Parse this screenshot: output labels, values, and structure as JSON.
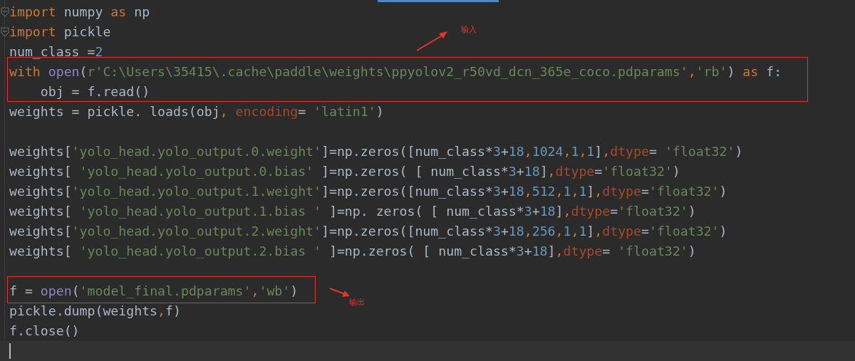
{
  "editor": {
    "lines": [
      {
        "tokens": [
          {
            "text": "import",
            "kind": "keyword"
          },
          {
            "text": " numpy ",
            "kind": "plain"
          },
          {
            "text": "as",
            "kind": "keyword"
          },
          {
            "text": " np",
            "kind": "plain"
          }
        ],
        "folded_marker": true
      },
      {
        "tokens": [
          {
            "text": "import",
            "kind": "keyword"
          },
          {
            "text": " pickle",
            "kind": "plain"
          }
        ],
        "folded_marker": true
      },
      {
        "tokens": [
          {
            "text": "num_class =",
            "kind": "plain"
          },
          {
            "text": "2",
            "kind": "number"
          }
        ]
      },
      {
        "tokens": [
          {
            "text": "with ",
            "kind": "keyword"
          },
          {
            "text": "open",
            "kind": "builtin"
          },
          {
            "text": "(",
            "kind": "plain"
          },
          {
            "text": "r'C:\\Users\\35415\\.cache\\paddle\\weights\\ppyolov2_r50vd_dcn_365e_coco.pdparams'",
            "kind": "string"
          },
          {
            "text": ",",
            "kind": "keyword"
          },
          {
            "text": "'rb'",
            "kind": "string"
          },
          {
            "text": ") ",
            "kind": "plain"
          },
          {
            "text": "as",
            "kind": "keyword"
          },
          {
            "text": " f:",
            "kind": "plain"
          }
        ]
      },
      {
        "tokens": [
          {
            "text": "    obj = f.read()",
            "kind": "plain"
          }
        ]
      },
      {
        "tokens": [
          {
            "text": "weights = pickle. loads(obj",
            "kind": "plain"
          },
          {
            "text": ", ",
            "kind": "keyword"
          },
          {
            "text": "encoding",
            "kind": "param"
          },
          {
            "text": "= ",
            "kind": "plain"
          },
          {
            "text": "'latin1'",
            "kind": "string"
          },
          {
            "text": ")",
            "kind": "plain"
          }
        ]
      },
      {
        "kind": "blank"
      },
      {
        "tokens": [
          {
            "text": "weights[",
            "kind": "plain"
          },
          {
            "text": "'yolo_head.yolo_output.0.weight'",
            "kind": "string"
          },
          {
            "text": "]=np.zeros([num_class*",
            "kind": "plain"
          },
          {
            "text": "3",
            "kind": "number"
          },
          {
            "text": "+",
            "kind": "plain"
          },
          {
            "text": "18",
            "kind": "number"
          },
          {
            "text": ",",
            "kind": "keyword"
          },
          {
            "text": "1024",
            "kind": "number"
          },
          {
            "text": ",",
            "kind": "keyword"
          },
          {
            "text": "1",
            "kind": "number"
          },
          {
            "text": ",",
            "kind": "keyword"
          },
          {
            "text": "1",
            "kind": "number"
          },
          {
            "text": "]",
            "kind": "plain"
          },
          {
            "text": ",",
            "kind": "keyword"
          },
          {
            "text": "dtype",
            "kind": "param"
          },
          {
            "text": "= ",
            "kind": "plain"
          },
          {
            "text": "'float32'",
            "kind": "string"
          },
          {
            "text": ")",
            "kind": "plain"
          }
        ]
      },
      {
        "tokens": [
          {
            "text": "weights[ ",
            "kind": "plain"
          },
          {
            "text": "'yolo_head.yolo_output.0.bias'",
            "kind": "string"
          },
          {
            "text": " ]=np.zeros( [ num_class*",
            "kind": "plain"
          },
          {
            "text": "3",
            "kind": "number"
          },
          {
            "text": "+",
            "kind": "plain"
          },
          {
            "text": "18",
            "kind": "number"
          },
          {
            "text": "]",
            "kind": "plain"
          },
          {
            "text": ",",
            "kind": "keyword"
          },
          {
            "text": "dtype",
            "kind": "param"
          },
          {
            "text": "=",
            "kind": "plain"
          },
          {
            "text": "'float32'",
            "kind": "string"
          },
          {
            "text": ")",
            "kind": "plain"
          }
        ]
      },
      {
        "tokens": [
          {
            "text": "weights[",
            "kind": "plain"
          },
          {
            "text": "'yolo_head.yolo_output.1.weight'",
            "kind": "string"
          },
          {
            "text": "]=np.zeros([num_class*",
            "kind": "plain"
          },
          {
            "text": "3",
            "kind": "number"
          },
          {
            "text": "+",
            "kind": "plain"
          },
          {
            "text": "18",
            "kind": "number"
          },
          {
            "text": ",",
            "kind": "keyword"
          },
          {
            "text": "512",
            "kind": "number"
          },
          {
            "text": ",",
            "kind": "keyword"
          },
          {
            "text": "1",
            "kind": "number"
          },
          {
            "text": ",",
            "kind": "keyword"
          },
          {
            "text": "1",
            "kind": "number"
          },
          {
            "text": "]",
            "kind": "plain"
          },
          {
            "text": ",",
            "kind": "keyword"
          },
          {
            "text": "dtype",
            "kind": "param"
          },
          {
            "text": "=",
            "kind": "plain"
          },
          {
            "text": "'float32'",
            "kind": "string"
          },
          {
            "text": ")",
            "kind": "plain"
          }
        ]
      },
      {
        "tokens": [
          {
            "text": "weights[ ",
            "kind": "plain"
          },
          {
            "text": "'yolo_head.yolo_output.1.bias '",
            "kind": "string"
          },
          {
            "text": " ]=np. zeros( [ num_class*",
            "kind": "plain"
          },
          {
            "text": "3",
            "kind": "number"
          },
          {
            "text": "+",
            "kind": "plain"
          },
          {
            "text": "18",
            "kind": "number"
          },
          {
            "text": "]",
            "kind": "plain"
          },
          {
            "text": ",",
            "kind": "keyword"
          },
          {
            "text": "dtype",
            "kind": "param"
          },
          {
            "text": "=",
            "kind": "plain"
          },
          {
            "text": "'float32'",
            "kind": "string"
          },
          {
            "text": ")",
            "kind": "plain"
          }
        ]
      },
      {
        "tokens": [
          {
            "text": "weights[",
            "kind": "plain"
          },
          {
            "text": "'yolo_head.yolo_output.2.weight'",
            "kind": "string"
          },
          {
            "text": "]=np.zeros([num_class*",
            "kind": "plain"
          },
          {
            "text": "3",
            "kind": "number"
          },
          {
            "text": "+",
            "kind": "plain"
          },
          {
            "text": "18",
            "kind": "number"
          },
          {
            "text": ",",
            "kind": "keyword"
          },
          {
            "text": "256",
            "kind": "number"
          },
          {
            "text": ",",
            "kind": "keyword"
          },
          {
            "text": "1",
            "kind": "number"
          },
          {
            "text": ",",
            "kind": "keyword"
          },
          {
            "text": "1",
            "kind": "number"
          },
          {
            "text": "]",
            "kind": "plain"
          },
          {
            "text": ",",
            "kind": "keyword"
          },
          {
            "text": "dtype",
            "kind": "param"
          },
          {
            "text": "=",
            "kind": "plain"
          },
          {
            "text": "'float32'",
            "kind": "string"
          },
          {
            "text": ")",
            "kind": "plain"
          }
        ]
      },
      {
        "tokens": [
          {
            "text": "weights[ ",
            "kind": "plain"
          },
          {
            "text": "'yolo_head.yolo_output.2.bias '",
            "kind": "string"
          },
          {
            "text": " ]=np.zeros( [ num_class*",
            "kind": "plain"
          },
          {
            "text": "3",
            "kind": "number"
          },
          {
            "text": "+",
            "kind": "plain"
          },
          {
            "text": "18",
            "kind": "number"
          },
          {
            "text": "]",
            "kind": "plain"
          },
          {
            "text": ",",
            "kind": "keyword"
          },
          {
            "text": "dtype",
            "kind": "param"
          },
          {
            "text": "= ",
            "kind": "plain"
          },
          {
            "text": "'float32'",
            "kind": "string"
          },
          {
            "text": ")",
            "kind": "plain"
          }
        ]
      },
      {
        "kind": "blank"
      },
      {
        "tokens": [
          {
            "text": "f = ",
            "kind": "plain"
          },
          {
            "text": "open",
            "kind": "builtin"
          },
          {
            "text": "(",
            "kind": "plain"
          },
          {
            "text": "'model_final.pdparams'",
            "kind": "string"
          },
          {
            "text": ",",
            "kind": "keyword"
          },
          {
            "text": "'wb'",
            "kind": "string"
          },
          {
            "text": ")",
            "kind": "plain"
          }
        ]
      },
      {
        "tokens": [
          {
            "text": "pickle.dump(weights",
            "kind": "plain"
          },
          {
            "text": ",",
            "kind": "keyword"
          },
          {
            "text": "f)",
            "kind": "plain"
          }
        ]
      },
      {
        "tokens": [
          {
            "text": "f.close()",
            "kind": "plain"
          }
        ]
      },
      {
        "current": true
      }
    ]
  },
  "annotations": [
    {
      "label": "输入"
    },
    {
      "label": "输出"
    }
  ]
}
